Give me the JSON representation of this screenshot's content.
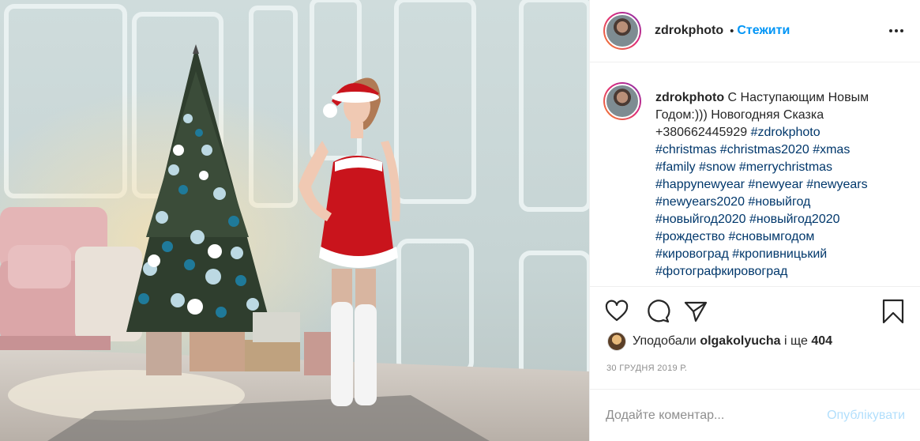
{
  "post": {
    "username": "zdrokphoto",
    "separator": "•",
    "follow_label": "Стежити",
    "caption_intro": "С Наступающим Новым Годом:))) Новогодняя Сказка +380662445929",
    "caption_tags": "#zdrokphoto\n#christmas #christmas2020 #xmas\n#family #snow #merrychristmas\n#happynewyear #newyear #newyears\n#newyears2020 #новыйгод\n#новыйгод2020 #новыйгод2020\n#рождество #сновымгодом\n#кировоград #кропивницький\n#фотографкировоград",
    "likes_prefix": "Уподобали",
    "likes_user": "olgakolyucha",
    "likes_mid": "і ще",
    "likes_count": "404",
    "date": "30 ГРУДНЯ 2019 Р.",
    "comment_placeholder": "Додайте коментар...",
    "publish_label": "Опублікувати"
  },
  "icons": {
    "more": "more-horizontal-icon",
    "like": "heart-icon",
    "comment": "comment-bubble-icon",
    "share": "paper-plane-icon",
    "save": "bookmark-icon"
  },
  "colors": {
    "link": "#0095f6",
    "hashtag": "#00376b",
    "publish_disabled": "#b2dffc",
    "secondary_text": "#8e8e8e"
  }
}
